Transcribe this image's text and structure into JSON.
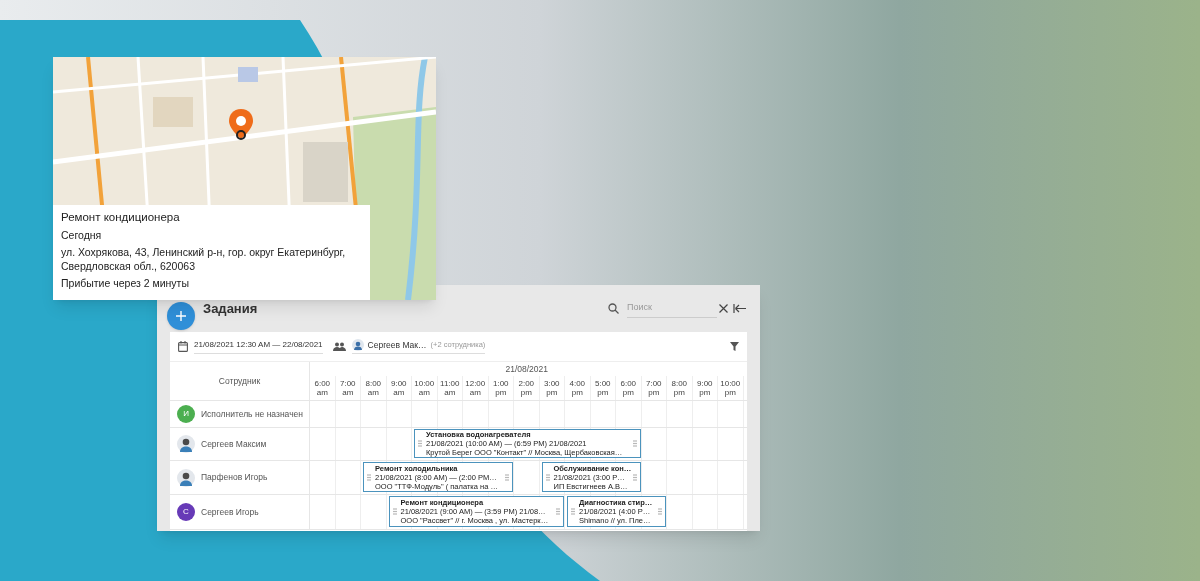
{
  "map_card": {
    "title": "Ремонт кондиционера",
    "day": "Сегодня",
    "address": "ул. Хохрякова, 43, Ленинский р-н, гор. округ Екатеринбург, Свердловская обл., 620063",
    "arrival": "Прибытие через 2 минуты"
  },
  "tasks": {
    "title": "Задания",
    "search": {
      "placeholder": "Поиск"
    },
    "filters": {
      "date_range": "21/08/2021 12:30 AM — 22/08/2021",
      "employee": "Сергеев Мак…",
      "extra": "(+2 сотрудника)"
    },
    "schedule": {
      "employee_header": "Сотрудник",
      "date": "21/08/2021",
      "hours": [
        {
          "time": "6:00",
          "period": "am"
        },
        {
          "time": "7:00",
          "period": "am"
        },
        {
          "time": "8:00",
          "period": "am"
        },
        {
          "time": "9:00",
          "period": "am"
        },
        {
          "time": "10:00",
          "period": "am"
        },
        {
          "time": "11:00",
          "period": "am"
        },
        {
          "time": "12:00",
          "period": "am"
        },
        {
          "time": "1:00",
          "period": "pm"
        },
        {
          "time": "2:00",
          "period": "pm"
        },
        {
          "time": "3:00",
          "period": "pm"
        },
        {
          "time": "4:00",
          "period": "pm"
        },
        {
          "time": "5:00",
          "period": "pm"
        },
        {
          "time": "6:00",
          "period": "pm"
        },
        {
          "time": "7:00",
          "period": "pm"
        },
        {
          "time": "8:00",
          "period": "pm"
        },
        {
          "time": "9:00",
          "period": "pm"
        },
        {
          "time": "10:00",
          "period": "pm"
        }
      ],
      "rows": [
        {
          "name": "Исполнитель не назначен",
          "avatar": {
            "kind": "letter",
            "letter": "И",
            "color": "#4caf50"
          }
        },
        {
          "name": "Сергеев Максим",
          "avatar": {
            "kind": "picture"
          },
          "events": [
            {
              "title": "Установка водонагревателя",
              "time": "21/08/2021 (10:00 AM) — (6:59 PM) 21/08/2021",
              "details": "Крутой Берег ООО \"Контакт\" // Москва, Щербаковская…"
            }
          ]
        },
        {
          "name": "Парфенов Игорь",
          "avatar": {
            "kind": "picture"
          },
          "events": [
            {
              "title": "Ремонт холодильника",
              "time": "21/08/2021 (8:00 AM) — (2:00 PM…",
              "details": "ООО \"ТТФ-Модуль\" ( палатка на …"
            },
            {
              "title": "Обслуживание кон…",
              "time": "21/08/2021 (3:00 P…",
              "details": "ИП Евстигнеев А.В…"
            }
          ]
        },
        {
          "name": "Сергеев Игорь",
          "avatar": {
            "kind": "letter",
            "letter": "С",
            "color": "#673ab7"
          },
          "events": [
            {
              "title": "Ремонт кондиционера",
              "time": "21/08/2021 (9:00 AM) — (3:59 PM) 21/08…",
              "details": "ООО \"Рассвет\" // г. Москва , ул. Мастерк…"
            },
            {
              "title": "Диагностика стир…",
              "time": "21/08/2021 (4:00 P…",
              "details": "Shimano // ул. Пле…"
            }
          ]
        }
      ]
    }
  }
}
